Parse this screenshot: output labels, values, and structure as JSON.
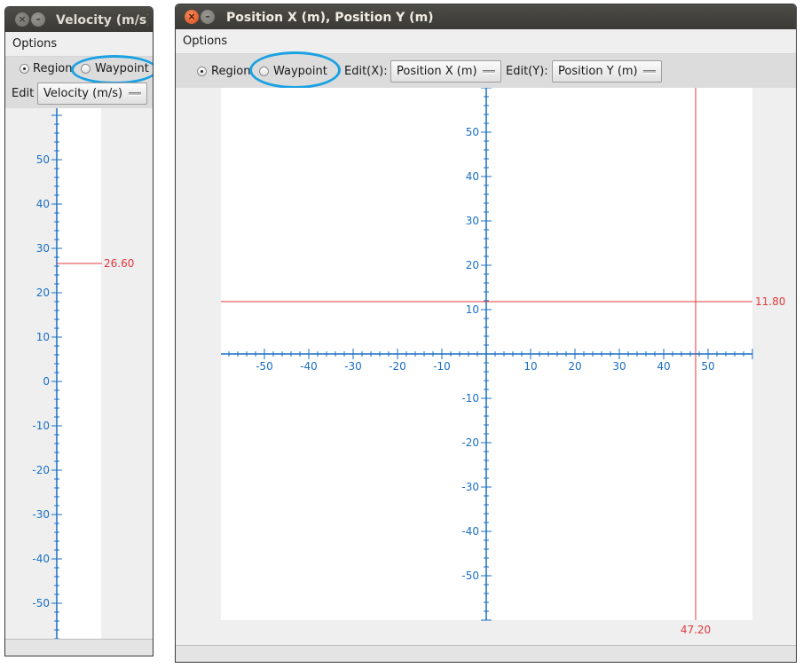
{
  "velocity_window": {
    "title": "Velocity (m/s)",
    "menu": [
      "Options"
    ],
    "mode": {
      "options": [
        "Region",
        "Waypoint"
      ],
      "selected": "Region",
      "highlighted": "Waypoint"
    },
    "edit_label": "Edit",
    "edit_value": "Velocity (m/s)"
  },
  "position_window": {
    "title": "Position X (m), Position Y (m)",
    "menu": [
      "Options"
    ],
    "mode": {
      "options": [
        "Region",
        "Waypoint"
      ],
      "selected": "Region",
      "highlighted": "Waypoint"
    },
    "edit_x_label": "Edit(X):",
    "edit_x_value": "Position X (m)",
    "edit_y_label": "Edit(Y):",
    "edit_y_value": "Position Y (m)"
  },
  "colors": {
    "axis": "#1a6fc4",
    "marker": "#e0393e",
    "highlight": "#1ba1e2"
  },
  "chart_data": [
    {
      "type": "axis-1d",
      "axis": "y",
      "ylim": [
        -60,
        60
      ],
      "major_ticks": [
        -50,
        -40,
        -30,
        -20,
        -10,
        0,
        10,
        20,
        30,
        40,
        50
      ],
      "minor_step": 2,
      "marker": {
        "y": 26.6,
        "label": "26.60"
      }
    },
    {
      "type": "scatter",
      "xlim": [
        -60,
        60
      ],
      "ylim": [
        -60,
        60
      ],
      "x_major_ticks": [
        -50,
        -40,
        -30,
        -20,
        -10,
        10,
        20,
        30,
        40,
        50
      ],
      "y_major_ticks": [
        -50,
        -40,
        -30,
        -20,
        -10,
        10,
        20,
        30,
        40,
        50
      ],
      "minor_step": 2,
      "crosshair": {
        "x": 47.2,
        "y": 11.8,
        "x_label": "47.20",
        "y_label": "11.80"
      }
    }
  ]
}
